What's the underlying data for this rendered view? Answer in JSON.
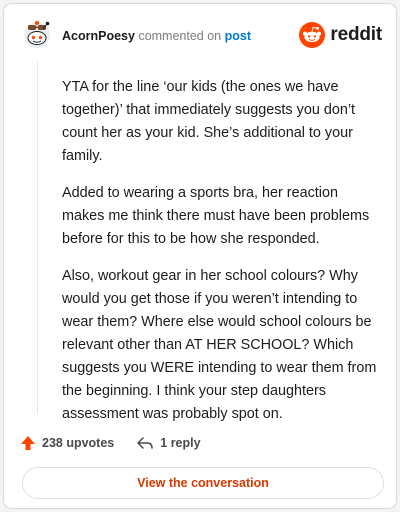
{
  "header": {
    "username": "AcornPoesy",
    "action_text": "commented on",
    "post_link": "post",
    "brand": "reddit"
  },
  "comment": {
    "paragraphs": [
      "YTA for the line ‘our kids (the ones we have together)’ that immediately suggests you don’t count her as your kid. She’s additional to your family.",
      "Added to wearing a sports bra, her reaction makes me think there must have been problems before for this to be how she responded.",
      "Also, workout gear in her school colours? Why would you get those if you weren’t intending to wear them? Where else would school colours be relevant other than AT HER SCHOOL? Which suggests you WERE intending to wear them from the beginning. I think your step daughters assessment was probably spot on."
    ]
  },
  "actions": {
    "upvotes": "238 upvotes",
    "replies": "1 reply"
  },
  "cta": {
    "label": "View the conversation"
  },
  "colors": {
    "brand_orange": "#ff4500",
    "link_blue": "#0079d3",
    "cta_text": "#d93a00"
  },
  "icons": {
    "avatar": "snoo-avatar-icon",
    "brand_logo": "reddit-logo-icon",
    "upvote": "upvote-arrow-icon",
    "reply": "reply-arrow-icon"
  }
}
